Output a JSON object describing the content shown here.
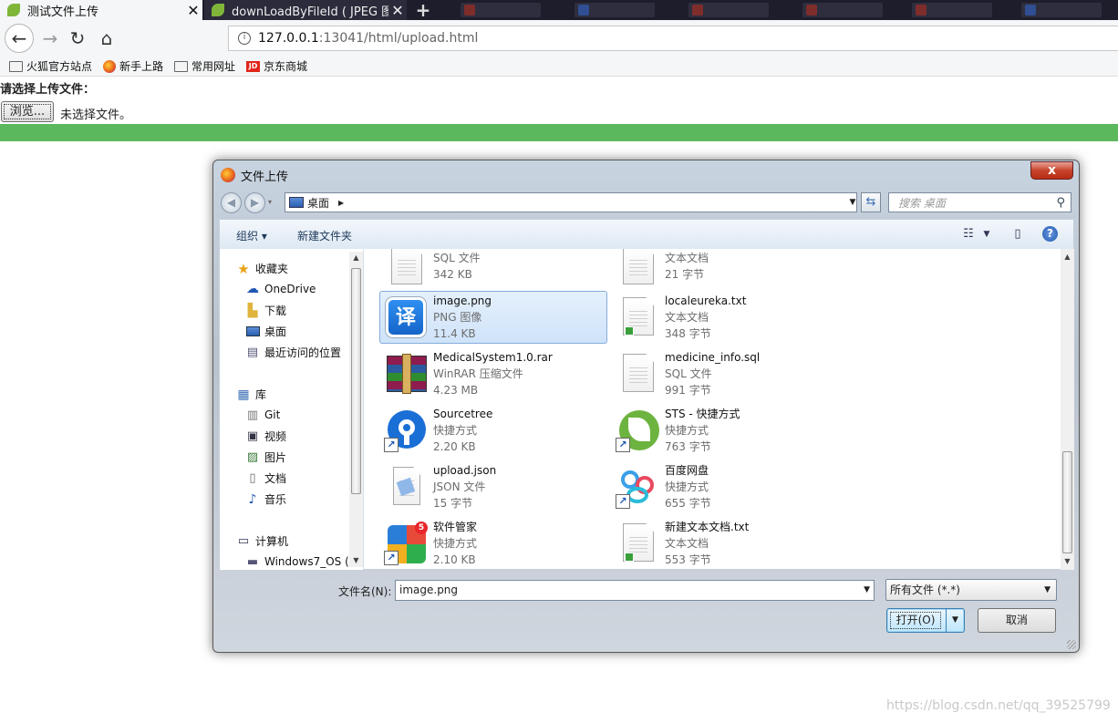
{
  "browser": {
    "tabs": [
      {
        "title": "测试文件上传",
        "active": true
      },
      {
        "title": "downLoadByFileId ( JPEG 图",
        "active": false
      }
    ],
    "new_tab": "+",
    "url_host": "127.0.0.1",
    "url_path": ":13041/html/upload.html",
    "bookmarks": [
      "火狐官方站点",
      "新手上路",
      "常用网址",
      "京东商城"
    ],
    "jd_icon_text": "JD"
  },
  "page": {
    "label": "请选择上传文件：",
    "browse_button": "浏览...",
    "no_file_text": "未选择文件。",
    "progress_percent": 100,
    "progress_color": "#5cb85c"
  },
  "dialog": {
    "title": "文件上传",
    "close": "x",
    "path": "桌面",
    "search_placeholder": "搜索 桌面",
    "toolbar": {
      "organize": "组织 ▾",
      "new_folder": "新建文件夹"
    },
    "nav_items": [
      {
        "label": "收藏夹",
        "icon": "star-icon"
      },
      {
        "label": "OneDrive",
        "icon": "cloud-icon"
      },
      {
        "label": "下载",
        "icon": "download-folder-icon"
      },
      {
        "label": "桌面",
        "icon": "desktop-icon"
      },
      {
        "label": "最近访问的位置",
        "icon": "recent-places-icon"
      },
      {
        "label": "库",
        "icon": "library-icon"
      },
      {
        "label": "Git",
        "icon": "library-folder-icon"
      },
      {
        "label": "视频",
        "icon": "video-icon"
      },
      {
        "label": "图片",
        "icon": "picture-icon"
      },
      {
        "label": "文档",
        "icon": "document-icon"
      },
      {
        "label": "音乐",
        "icon": "music-icon"
      },
      {
        "label": "计算机",
        "icon": "computer-icon"
      },
      {
        "label": "Windows7_OS (",
        "icon": "drive-icon"
      }
    ],
    "files": [
      {
        "name": "",
        "type": "SQL 文件",
        "size": "342 KB",
        "icon": "document-icon"
      },
      {
        "name": "",
        "type": "文本文档",
        "size": "21 字节",
        "icon": "document-icon"
      },
      {
        "name": "image.png",
        "type": "PNG 图像",
        "size": "11.4 KB",
        "icon": "translate-app-icon",
        "icon_text": "译",
        "selected": true
      },
      {
        "name": "localeureka.txt",
        "type": "文本文档",
        "size": "348 字节",
        "icon": "text-file-icon"
      },
      {
        "name": "MedicalSystem1.0.rar",
        "type": "WinRAR 压缩文件",
        "size": "4.23 MB",
        "icon": "winrar-icon"
      },
      {
        "name": "medicine_info.sql",
        "type": "SQL 文件",
        "size": "991 字节",
        "icon": "document-icon"
      },
      {
        "name": "Sourcetree",
        "type": "快捷方式",
        "size": "2.20 KB",
        "icon": "sourcetree-icon"
      },
      {
        "name": "STS - 快捷方式",
        "type": "快捷方式",
        "size": "763 字节",
        "icon": "sts-leaf-icon"
      },
      {
        "name": "upload.json",
        "type": "JSON 文件",
        "size": "15 字节",
        "icon": "json-file-icon"
      },
      {
        "name": "百度网盘",
        "type": "快捷方式",
        "size": "655 字节",
        "icon": "baidu-netdisk-icon"
      },
      {
        "name": "软件管家",
        "type": "快捷方式",
        "size": "2.10 KB",
        "icon": "software-manager-icon",
        "badge": "5"
      },
      {
        "name": "新建文本文档.txt",
        "type": "文本文档",
        "size": "553 字节",
        "icon": "text-file-icon"
      }
    ],
    "filename_label": "文件名(N):",
    "filename_value": "image.png",
    "filetype_value": "所有文件 (*.*)",
    "open_button": "打开(O)",
    "cancel_button": "取消"
  },
  "watermark": "https://blog.csdn.net/qq_39525799"
}
